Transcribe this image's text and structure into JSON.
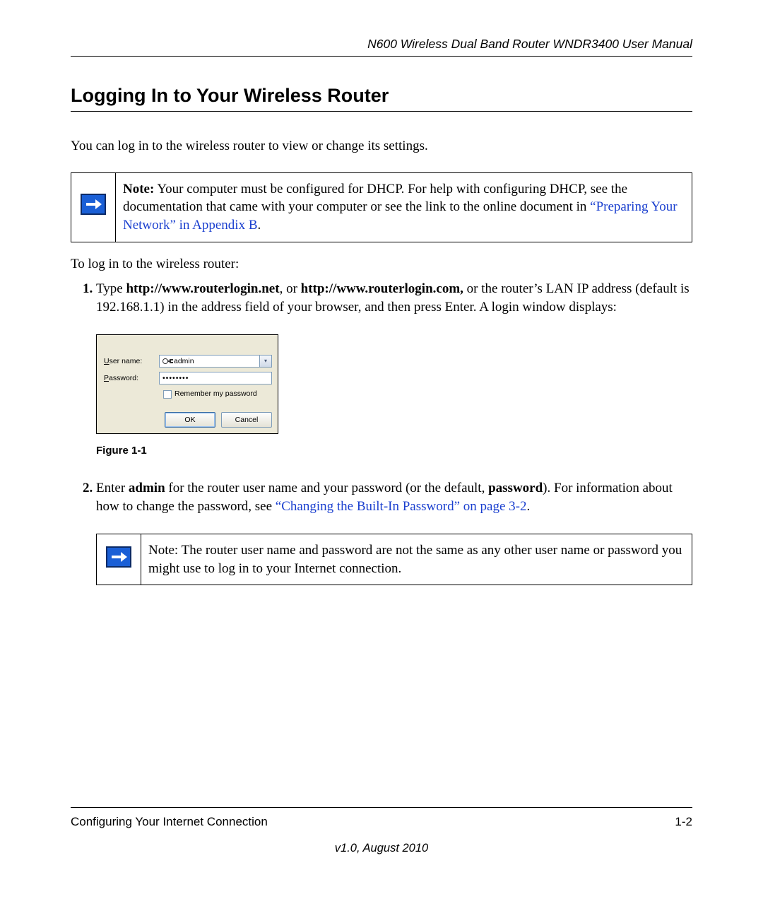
{
  "header": {
    "manual_title": "N600 Wireless Dual Band Router WNDR3400 User Manual"
  },
  "section": {
    "title": "Logging In to Your Wireless Router"
  },
  "intro": "You can log in to the wireless router to view or change its settings.",
  "note1": {
    "label": "Note:",
    "text_before_link": " Your computer must be configured for DHCP. For help with configuring DHCP, see the documentation that came with your computer or see the link to the online document in ",
    "link": "“Preparing Your Network” in Appendix B",
    "text_after_link": "."
  },
  "lead_in": "To log in to the wireless router:",
  "step1": {
    "pre_bold1": "Type ",
    "bold1": "http://www.routerlogin.net",
    "mid1": ", or ",
    "bold2": "http://www.routerlogin.com,",
    "post": " or the router’s LAN IP address (default is 192.168.1.1) in the address field of your browser, and then press Enter. A login window displays:"
  },
  "login_window": {
    "username_label_u": "U",
    "username_label_rest": "ser name:",
    "password_label_u": "P",
    "password_label_rest": "assword:",
    "username_value": "admin",
    "password_mask": "••••••••",
    "remember_u": "R",
    "remember_rest": "emember my password",
    "ok": "OK",
    "cancel": "Cancel"
  },
  "figure_caption": "Figure 1-1",
  "step2": {
    "t1": "Enter ",
    "b1": "admin",
    "t2": " for the router user name and your password (or the default, ",
    "b2": "password",
    "t3": "). For information about how to change the password, see ",
    "link": "“Changing the Built-In Password” on page 3-2",
    "t4": "."
  },
  "note2": {
    "label": "Note:",
    "text": " The router user name and password are not the same as any other user name or password you might use to log in to your Internet connection."
  },
  "footer": {
    "left": "Configuring Your Internet Connection",
    "right": "1-2",
    "version": "v1.0, August 2010"
  }
}
